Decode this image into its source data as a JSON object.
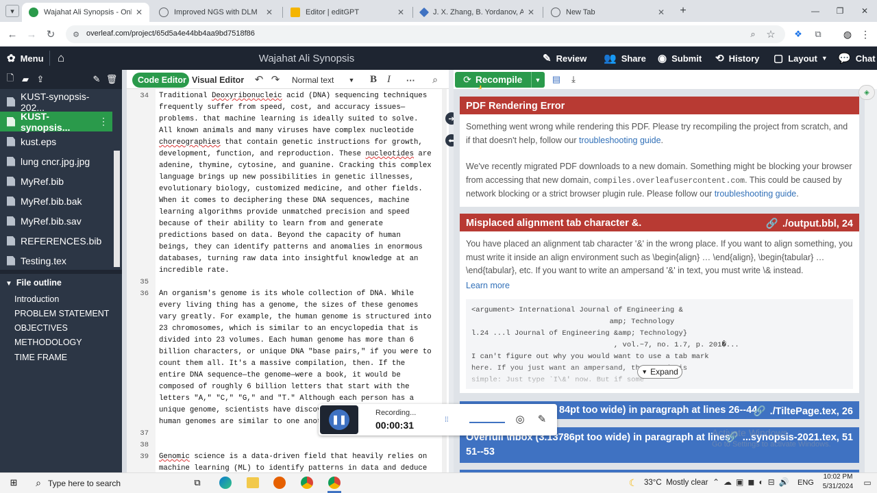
{
  "browser": {
    "tabs": [
      {
        "title": "Wajahat Ali Synopsis - Online L",
        "active": true,
        "favicon_color": "#2a9a4b"
      },
      {
        "title": "Improved NGS with DLM",
        "active": false,
        "favicon_color": "#5f6368"
      },
      {
        "title": "Editor | editGPT",
        "active": false,
        "favicon_color": "#f4b400"
      },
      {
        "title": "J. X. Zhang, B. Yordanov, A. Gau",
        "active": false,
        "favicon_color": "#3f72c2"
      },
      {
        "title": "New Tab",
        "active": false,
        "favicon_color": "#5f6368"
      }
    ],
    "url": "overleaf.com/project/65d5a4e44bb4aa9bd7518f86"
  },
  "overleaf": {
    "menu_label": "Menu",
    "project_title": "Wajahat Ali Synopsis",
    "toolbar": {
      "review": "Review",
      "share": "Share",
      "submit": "Submit",
      "history": "History",
      "layout": "Layout",
      "chat": "Chat"
    },
    "editor_toolbar": {
      "code_editor": "Code Editor",
      "visual_editor": "Visual Editor",
      "style_select": "Normal text",
      "bold": "B",
      "italic": "I",
      "more": "···"
    },
    "recompile": "Recompile",
    "files": [
      {
        "name": "KUST-synopsis-202...",
        "selected": false
      },
      {
        "name": "KUST-synopsis...",
        "selected": true
      },
      {
        "name": "kust.eps",
        "selected": false
      },
      {
        "name": "lung cncr.jpg.jpg",
        "selected": false
      },
      {
        "name": "MyRef.bib",
        "selected": false
      },
      {
        "name": "MyRef.bib.bak",
        "selected": false
      },
      {
        "name": "MyRef.bib.sav",
        "selected": false
      },
      {
        "name": "REFERENCES.bib",
        "selected": false
      },
      {
        "name": "Testing.tex",
        "selected": false
      }
    ],
    "outline": {
      "title": "File outline",
      "items": [
        "Introduction",
        "PROBLEM STATEMENT",
        "OBJECTIVES",
        "METHODOLOGY",
        "TIME FRAME"
      ]
    },
    "code_lines": [
      {
        "num": "34",
        "text": "Traditional Deoxyribonucleic acid (DNA) sequencing techniques"
      },
      {
        "num": "",
        "text": "frequently suffer from speed, cost, and accuracy issues—"
      },
      {
        "num": "",
        "text": "problems. that machine learning is ideally suited to solve."
      },
      {
        "num": "",
        "text": "All known animals and many viruses have complex nucleotide"
      },
      {
        "num": "",
        "text": "choreographies that contain genetic instructions for growth,"
      },
      {
        "num": "",
        "text": "development, function, and reproduction. These nucleotides are"
      },
      {
        "num": "",
        "text": "adenine, thymine, cytosine, and guanine. Cracking this complex"
      },
      {
        "num": "",
        "text": "language brings up new possibilities in genetic illnesses,"
      },
      {
        "num": "",
        "text": "evolutionary biology, customized medicine, and other fields."
      },
      {
        "num": "",
        "text": "When it comes to deciphering these DNA sequences, machine"
      },
      {
        "num": "",
        "text": "learning algorithms provide unmatched precision and speed"
      },
      {
        "num": "",
        "text": "because of their ability to learn from and generate"
      },
      {
        "num": "",
        "text": "predictions based on data. Beyond the capacity of human"
      },
      {
        "num": "",
        "text": "beings, they can identify patterns and anomalies in enormous"
      },
      {
        "num": "",
        "text": "databases, turning raw data into insightful knowledge at an"
      },
      {
        "num": "",
        "text": "incredible rate."
      },
      {
        "num": "35",
        "text": ""
      },
      {
        "num": "36",
        "text": "An organism's genome is its whole collection of DNA. While"
      },
      {
        "num": "",
        "text": "every living thing has a genome, the sizes of these genomes"
      },
      {
        "num": "",
        "text": "vary greatly. For example, the human genome is structured into"
      },
      {
        "num": "",
        "text": "23 chromosomes, which is similar to an encyclopedia that is"
      },
      {
        "num": "",
        "text": "divided into 23 volumes. Each human genome has more than 6"
      },
      {
        "num": "",
        "text": "billion characters, or unique DNA \"base pairs,\" if you were to"
      },
      {
        "num": "",
        "text": "count them all. It's a massive compilation, then. If the"
      },
      {
        "num": "",
        "text": "entire DNA sequence—the genome—were a book, it would be"
      },
      {
        "num": "",
        "text": "composed of roughly 6 billion letters that start with the"
      },
      {
        "num": "",
        "text": "letters \"A,\" \"C,\" \"G,\" and \"T.\" Although each person has a"
      },
      {
        "num": "",
        "text": "unique genome, scientists have discov"
      },
      {
        "num": "",
        "text": "human genomes are similar to one anot"
      },
      {
        "num": "37",
        "text": ""
      },
      {
        "num": "38",
        "text": ""
      },
      {
        "num": "39",
        "text": "Genomic science is a data-driven field that heavily relies on"
      },
      {
        "num": "",
        "text": "machine learning (ML) to identify patterns in data and deduce"
      }
    ],
    "logs": {
      "pdf_error": {
        "title": "PDF Rendering Error",
        "p1": "Something went wrong while rendering this PDF. Please try recompiling the project from scratch, and if that doesn't help, follow our",
        "p1_link": "troubleshooting guide",
        "p2": "We've recently migrated PDF downloads to a new domain. Something might be blocking your browser from accessing that new domain,",
        "p2_code": "compiles.overleafusercontent.com",
        "p2_b": ". This could be caused by network blocking or a strict browser plugin rule. Please follow our",
        "p2_link": "troubleshooting guide"
      },
      "misplaced": {
        "title": "Misplaced alignment tab character &.",
        "location": "./output.bbl, 24",
        "text": "You have placed an alignment tab character '&' in the wrong place. If you want to align something, you must write it inside an align environment such as \\begin{align} … \\end{align}, \\begin{tabular} … \\end{tabular}, etc. If you want to write an ampersand '&' in text, you must write \\& instead.",
        "learn_more": "Learn more",
        "raw": [
          "<argument> International Journal of Engineering &",
          "                                amp; Technology",
          "l.24 ...l Journal of Engineering &amp; Technology}",
          "                                 , vol.~7, no. 1.7, p. 201�...",
          "I can't figure out why you would want to use a tab mark",
          "here. If you just want an ampersand, the remedy is",
          "simple: Just type `I\\&' now. But if some"
        ],
        "expand": "Expand"
      },
      "overfull1": {
        "title": "84pt too wide) in paragraph at lines 26--44",
        "location": "./TiltePage.tex, 26"
      },
      "overfull2": {
        "title": "Overfull \\hbox (3.13786pt too wide) in paragraph at lines",
        "title2": "51--53",
        "location": "...synopsis-2021.tex, 51"
      }
    }
  },
  "recorder": {
    "status": "Recording...",
    "time": "00:00:31"
  },
  "watermark": {
    "line1": "Activate Windows",
    "line2": "Go to Settings to activate Windows."
  },
  "taskbar": {
    "search_placeholder": "Type here to search",
    "weather": "33°C  Mostly clear",
    "lang": "ENG",
    "time": "10:02 PM",
    "date": "5/31/2024"
  }
}
